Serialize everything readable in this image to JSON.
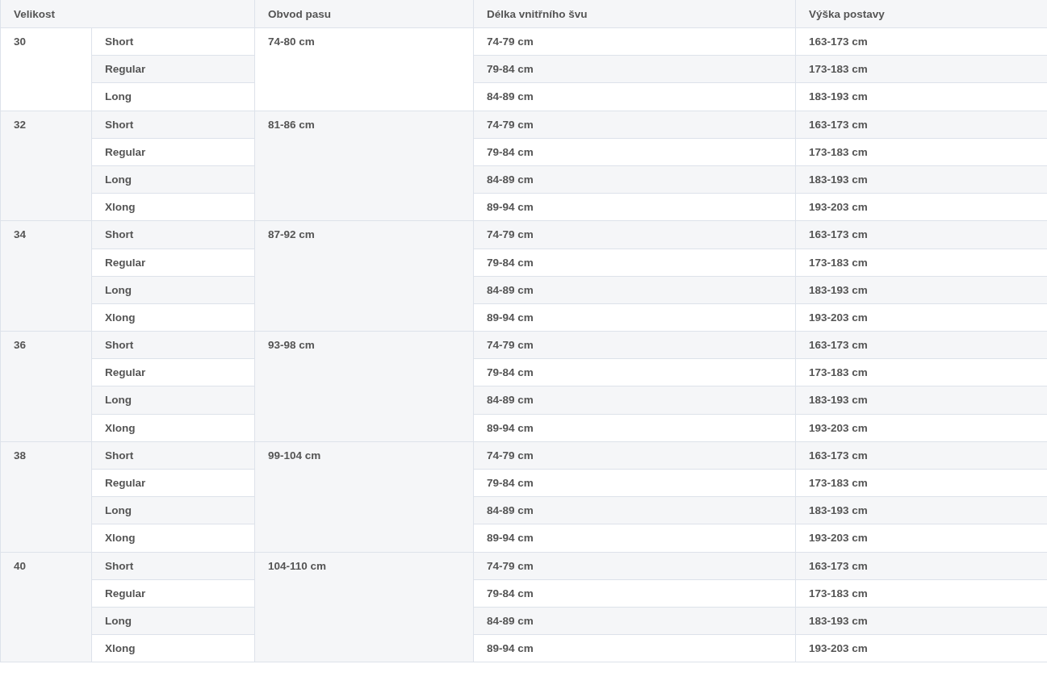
{
  "table": {
    "columns": [
      "Velikost",
      "Obvod pasu",
      "Délka vnitřního švu",
      "Výška postavy"
    ],
    "groups": [
      {
        "size": "30",
        "waist": "74-80 cm",
        "rows": [
          {
            "length": "Short",
            "inseam": "74-79 cm",
            "height": "163-173 cm"
          },
          {
            "length": "Regular",
            "inseam": "79-84 cm",
            "height": "173-183 cm"
          },
          {
            "length": "Long",
            "inseam": "84-89 cm",
            "height": "183-193 cm"
          }
        ]
      },
      {
        "size": "32",
        "waist": "81-86 cm",
        "rows": [
          {
            "length": "Short",
            "inseam": "74-79 cm",
            "height": "163-173 cm"
          },
          {
            "length": "Regular",
            "inseam": "79-84 cm",
            "height": "173-183 cm"
          },
          {
            "length": "Long",
            "inseam": "84-89 cm",
            "height": "183-193 cm"
          },
          {
            "length": "Xlong",
            "inseam": "89-94 cm",
            "height": "193-203 cm"
          }
        ]
      },
      {
        "size": "34",
        "waist": "87-92 cm",
        "rows": [
          {
            "length": "Short",
            "inseam": "74-79 cm",
            "height": "163-173 cm"
          },
          {
            "length": "Regular",
            "inseam": "79-84 cm",
            "height": "173-183 cm"
          },
          {
            "length": "Long",
            "inseam": "84-89 cm",
            "height": "183-193 cm"
          },
          {
            "length": "Xlong",
            "inseam": "89-94 cm",
            "height": "193-203 cm"
          }
        ]
      },
      {
        "size": "36",
        "waist": "93-98 cm",
        "rows": [
          {
            "length": "Short",
            "inseam": "74-79 cm",
            "height": "163-173 cm"
          },
          {
            "length": "Regular",
            "inseam": "79-84 cm",
            "height": "173-183 cm"
          },
          {
            "length": "Long",
            "inseam": "84-89 cm",
            "height": "183-193 cm"
          },
          {
            "length": "Xlong",
            "inseam": "89-94 cm",
            "height": "193-203 cm"
          }
        ]
      },
      {
        "size": "38",
        "waist": "99-104 cm",
        "rows": [
          {
            "length": "Short",
            "inseam": "74-79 cm",
            "height": "163-173 cm"
          },
          {
            "length": "Regular",
            "inseam": "79-84 cm",
            "height": "173-183 cm"
          },
          {
            "length": "Long",
            "inseam": "84-89 cm",
            "height": "183-193 cm"
          },
          {
            "length": "Xlong",
            "inseam": "89-94 cm",
            "height": "193-203 cm"
          }
        ]
      },
      {
        "size": "40",
        "waist": "104-110 cm",
        "rows": [
          {
            "length": "Short",
            "inseam": "74-79 cm",
            "height": "163-173 cm"
          },
          {
            "length": "Regular",
            "inseam": "79-84 cm",
            "height": "173-183 cm"
          },
          {
            "length": "Long",
            "inseam": "84-89 cm",
            "height": "183-193 cm"
          },
          {
            "length": "Xlong",
            "inseam": "89-94 cm",
            "height": "193-203 cm"
          }
        ]
      }
    ]
  }
}
